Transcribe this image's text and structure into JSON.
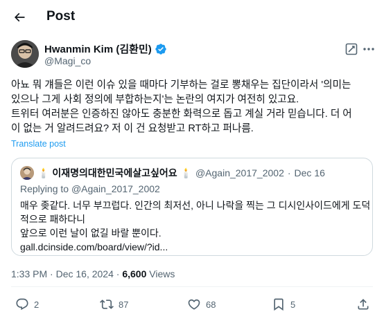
{
  "header": {
    "title": "Post"
  },
  "author": {
    "name": "Hwanmin Kim (김환민)",
    "handle": "@Magi_co"
  },
  "body": {
    "lines": [
      "아뇨 뭐 걔들은 이런 이슈 있을 때마다 기부하는 걸로 뽕채우는 집단이라서 '의미는",
      "있으나 그게 사회 정의에 부합하는지'는 논란의 여지가 여전히 있고요.",
      "트위터 여러분은 인증하진 않아도 충분한 화력으로 돕고 계실 거라 믿습니다. 더 어",
      "이 없는 거 알려드려요? 저 이 건 요청받고 RT하고 퍼나름."
    ]
  },
  "translate_label": "Translate post",
  "quote": {
    "name": "🕯️ 이재명의대한민국에살고싶어요 🕯️",
    "handle": "@Again_2017_2002",
    "separator": "·",
    "date": "Dec 16",
    "replying_prefix": "Replying to",
    "replying_handle": "@Again_2017_2002",
    "lines": [
      "매우 좆같다. 너무 부끄럽다. 인간의 최저선, 아니 나락을 찍는 그 디시인사이드에게 도덕",
      "적으로 패하다니",
      "앞으로 이런 날이 없길 바랄 뿐이다.",
      "gall.dcinside.com/board/view/?id..."
    ]
  },
  "meta": {
    "time": "1:33 PM",
    "separator": "·",
    "date": "Dec 16, 2024",
    "views_count": "6,600",
    "views_label": "Views"
  },
  "actions": {
    "replies": "2",
    "reposts": "87",
    "likes": "68",
    "bookmarks": "5"
  },
  "colors": {
    "text": "#0f1419",
    "secondary": "#536471",
    "link": "#1d9bf0",
    "border": "#cfd9de",
    "verified": "#1d9bf0"
  },
  "icons": [
    "back-arrow-icon",
    "verified-badge-icon",
    "grok-icon",
    "more-icon",
    "reply-icon",
    "repost-icon",
    "like-icon",
    "bookmark-icon",
    "share-icon"
  ]
}
